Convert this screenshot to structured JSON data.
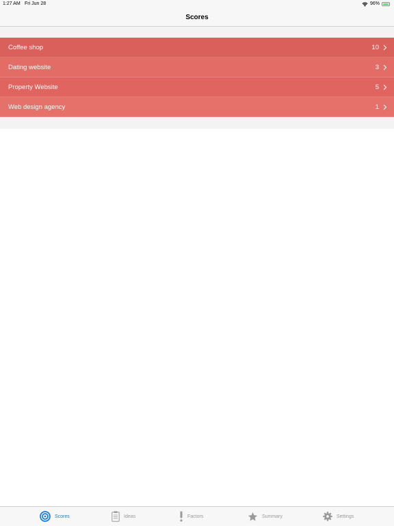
{
  "status_bar": {
    "time": "1:27 AM",
    "date": "Fri Jun 28",
    "battery_percent": "96%",
    "battery_level": 0.96
  },
  "nav": {
    "title": "Scores"
  },
  "scores": [
    {
      "name": "Coffee shop",
      "value": "10",
      "color": "#d9605b"
    },
    {
      "name": "Dating website",
      "value": "3",
      "color": "#e46c67"
    },
    {
      "name": "Property Website",
      "value": "5",
      "color": "#e0645f"
    },
    {
      "name": "Web design agency",
      "value": "1",
      "color": "#e6716b"
    }
  ],
  "tabs": [
    {
      "label": "Scores",
      "icon": "target-icon",
      "active": true
    },
    {
      "label": "Ideas",
      "icon": "clipboard-icon",
      "active": false
    },
    {
      "label": "Factors",
      "icon": "exclamation-icon",
      "active": false
    },
    {
      "label": "Summary",
      "icon": "star-icon",
      "active": false
    },
    {
      "label": "Settings",
      "icon": "gear-icon",
      "active": false
    }
  ],
  "colors": {
    "active_tab": "#1a7ee0",
    "inactive_tab": "#9a9a9a"
  }
}
